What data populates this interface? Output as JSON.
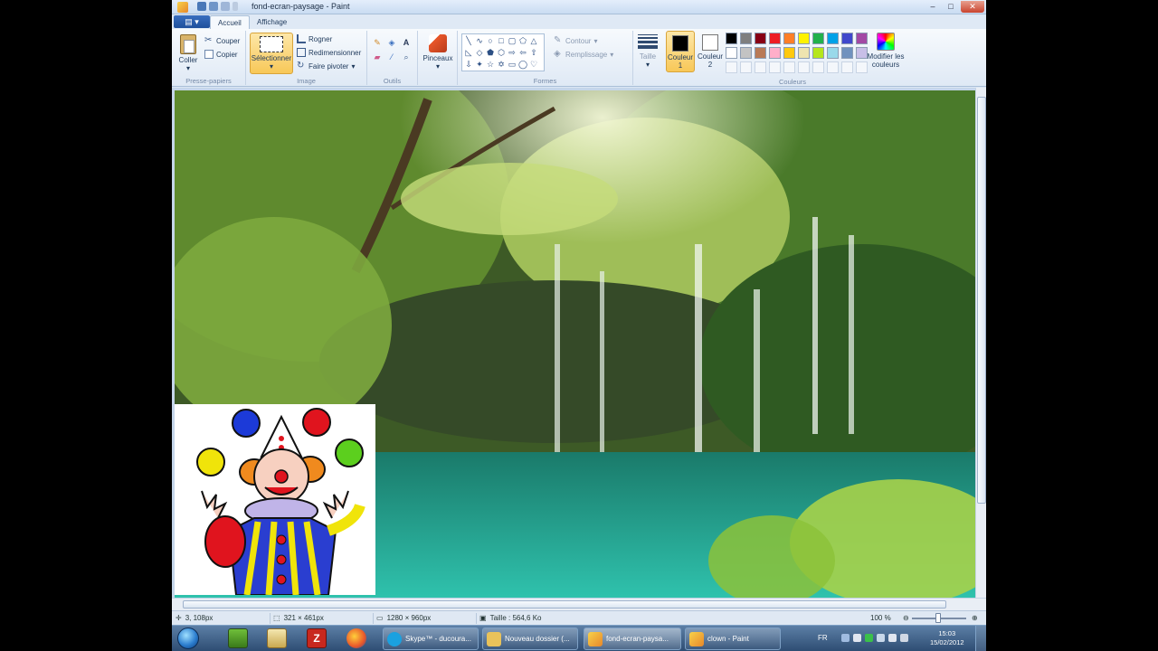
{
  "window": {
    "title": "fond-ecran-paysage - Paint"
  },
  "tabs": [
    {
      "label": "Accueil"
    },
    {
      "label": "Affichage"
    }
  ],
  "clipboard": {
    "paste": "Coller",
    "cut": "Couper",
    "copy": "Copier",
    "group": "Presse-papiers"
  },
  "image": {
    "select": "Sélectionner",
    "crop": "Rogner",
    "resize": "Redimensionner",
    "rotate": "Faire pivoter",
    "group": "Image"
  },
  "tools": {
    "group": "Outils",
    "brushes": "Pinceaux"
  },
  "shapes": {
    "outline": "Contour",
    "fill": "Remplissage",
    "group": "Formes"
  },
  "size": {
    "label": "Taille"
  },
  "colors": {
    "color1_label": "Couleur 1",
    "color2_label": "Couleur 2",
    "edit_label": "Modifier les couleurs",
    "group": "Couleurs",
    "color1_value": "#000000",
    "color2_value": "#ffffff",
    "palette_row1": [
      "#000000",
      "#7f7f7f",
      "#880015",
      "#ed1c24",
      "#ff7f27",
      "#fff200",
      "#22b14c",
      "#00a2e8",
      "#3f48cc",
      "#a349a4"
    ],
    "palette_row2": [
      "#ffffff",
      "#c3c3c3",
      "#b97a57",
      "#ffaec9",
      "#ffc90e",
      "#efe4b0",
      "#b5e61d",
      "#99d9ea",
      "#7092be",
      "#c8bfe7"
    ]
  },
  "status": {
    "cursor": "3, 108px",
    "selection": "321 × 461px",
    "image_size": "1280 × 960px",
    "file_size": "Taille : 564,6 Ko",
    "zoom": "100 %"
  },
  "taskbar": {
    "tasks": [
      {
        "label": "Skype™ - ducoura...",
        "color": "#1aa1e0"
      },
      {
        "label": "Nouveau dossier (...",
        "color": "#e9c25a"
      },
      {
        "label": "fond-ecran-paysa...",
        "color": "#e8872a"
      },
      {
        "label": "clown - Paint",
        "color": "#e8872a"
      }
    ],
    "lang": "FR",
    "time": "15:03",
    "date": "15/02/2012"
  }
}
